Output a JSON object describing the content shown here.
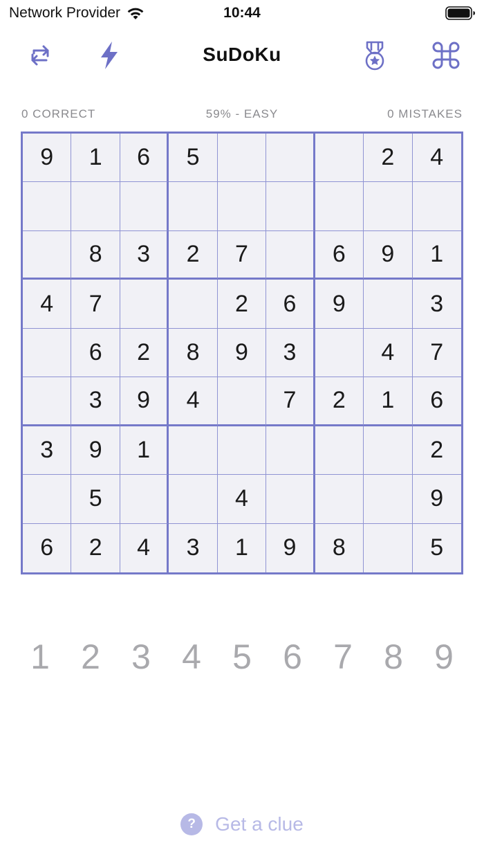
{
  "status_bar": {
    "carrier": "Network Provider",
    "time": "10:44"
  },
  "toolbar": {
    "title": "SuDoKu",
    "icons": {
      "restart": "repeat-icon",
      "flash": "bolt-icon",
      "achievements": "medal-icon",
      "shortcuts": "command-icon"
    }
  },
  "stats": {
    "correct": "0 CORRECT",
    "difficulty": "59% - EASY",
    "mistakes": "0 MISTAKES"
  },
  "board": {
    "rows": [
      [
        "9",
        "1",
        "6",
        "5",
        "",
        "",
        "",
        "2",
        "4"
      ],
      [
        "",
        "",
        "",
        "",
        "",
        "",
        "",
        "",
        ""
      ],
      [
        "",
        "8",
        "3",
        "2",
        "7",
        "",
        "6",
        "9",
        "1"
      ],
      [
        "4",
        "7",
        "",
        "",
        "2",
        "6",
        "9",
        "",
        "3"
      ],
      [
        "",
        "6",
        "2",
        "8",
        "9",
        "3",
        "",
        "4",
        "7"
      ],
      [
        "",
        "3",
        "9",
        "4",
        "",
        "7",
        "2",
        "1",
        "6"
      ],
      [
        "3",
        "9",
        "1",
        "",
        "",
        "",
        "",
        "",
        "2"
      ],
      [
        "",
        "5",
        "",
        "",
        "4",
        "",
        "",
        "",
        "9"
      ],
      [
        "6",
        "2",
        "4",
        "3",
        "1",
        "9",
        "8",
        "",
        "5"
      ]
    ]
  },
  "numpad": [
    "1",
    "2",
    "3",
    "4",
    "5",
    "6",
    "7",
    "8",
    "9"
  ],
  "clue": {
    "icon": "?",
    "label": "Get a clue"
  },
  "colors": {
    "accent": "#7579c9",
    "board_bg": "#f1f1f6",
    "muted": "#a9a9ad",
    "clue": "#b7b9e6"
  }
}
